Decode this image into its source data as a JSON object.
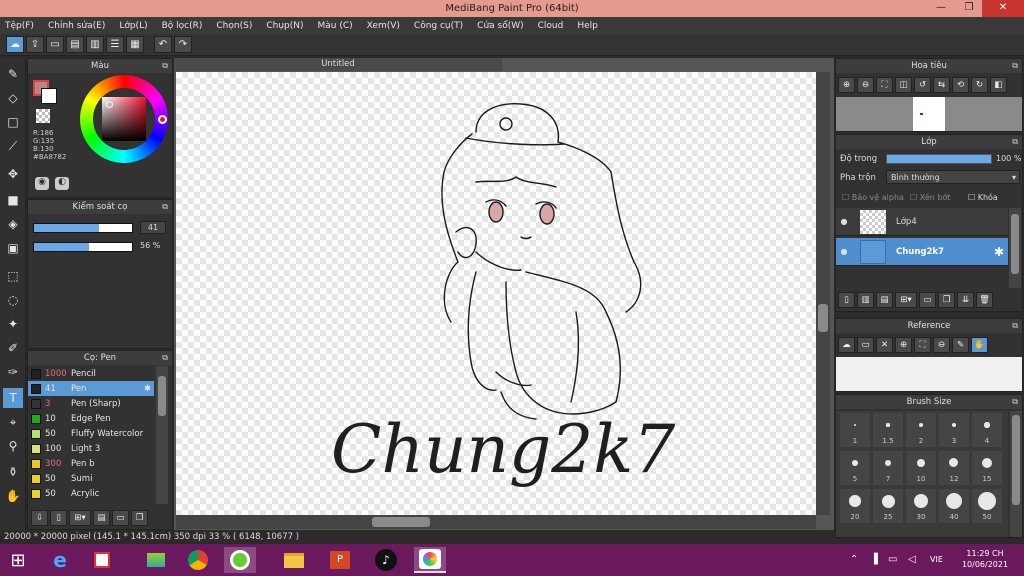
{
  "window": {
    "title": "MediBang Paint Pro (64bit)",
    "min": "—",
    "max": "❐",
    "close": "✕"
  },
  "menu": [
    "Tệp(F)",
    "Chỉnh sửa(E)",
    "Lớp(L)",
    "Bộ lọc(R)",
    "Chọn(S)",
    "Chụp(N)",
    "Màu (C)",
    "Xem(V)",
    "Công cụ(T)",
    "Cửa sổ(W)",
    "Cloud",
    "Help"
  ],
  "color_panel": {
    "title": "Màu",
    "r": "R:186",
    "g": "G:135",
    "b": "B:130",
    "hex": "#BA8782",
    "primary_color": "#BA8782",
    "secondary_color": "#ffffff"
  },
  "brush_control": {
    "title": "Kiểm soát cọ",
    "size_value": "41",
    "opacity_value": "56 %",
    "size_fill": 0.66,
    "opacity_fill": 0.56
  },
  "brush_panel": {
    "title": "Cọ: Pen",
    "items": [
      {
        "num": "1000",
        "name": "Pencil",
        "color": "#222222",
        "num_color": "#e07070"
      },
      {
        "num": "41",
        "name": "Pen",
        "color": "#222222",
        "num_color": "#ffffff",
        "selected": true
      },
      {
        "num": "3",
        "name": "Pen (Sharp)",
        "color": "#333333",
        "num_color": "#e07070"
      },
      {
        "num": "10",
        "name": "Edge Pen",
        "color": "#1ab01a",
        "num_color": "#e6e6e6"
      },
      {
        "num": "50",
        "name": "Fluffy Watercolor",
        "color": "#b8e070",
        "num_color": "#e6e6e6"
      },
      {
        "num": "100",
        "name": "Light 3",
        "color": "#d8e080",
        "num_color": "#e6e6e6"
      },
      {
        "num": "300",
        "name": "Pen b",
        "color": "#e8c820",
        "num_color": "#e07070"
      },
      {
        "num": "50",
        "name": "Sumi",
        "color": "#e8d030",
        "num_color": "#e6e6e6"
      },
      {
        "num": "50",
        "name": "Acrylic",
        "color": "#e8d030",
        "num_color": "#e6e6e6"
      }
    ]
  },
  "document": {
    "tab": "Untitled",
    "artwork_text": "Chung2k7"
  },
  "status": {
    "text": "20000 * 20000 pixel   (145.1 * 145.1cm)   350 dpi   33 %   ( 6148, 10677 )"
  },
  "navigator": {
    "title": "Hoa tiêu"
  },
  "layer_panel": {
    "title": "Lớp",
    "opacity_label": "Độ trong",
    "opacity_value": "100 %",
    "opacity_fill": 1.0,
    "blend_label": "Pha trộn",
    "blend_value": "Bình thường",
    "protect_alpha": "Bảo vệ alpha",
    "clipping": "Xén bớt",
    "lock": "Khóa",
    "layers": [
      {
        "name": "Lớp4",
        "selected": false
      },
      {
        "name": "Chung2k7",
        "selected": true
      }
    ]
  },
  "reference_panel": {
    "title": "Reference"
  },
  "brush_size_panel": {
    "title": "Brush Size",
    "sizes": [
      "1",
      "1.5",
      "2",
      "3",
      "4",
      "5",
      "7",
      "10",
      "12",
      "15",
      "20",
      "25",
      "30",
      "40",
      "50"
    ]
  },
  "taskbar": {
    "lang": "VIE",
    "time": "11:29 CH",
    "date": "10/06/2021"
  }
}
